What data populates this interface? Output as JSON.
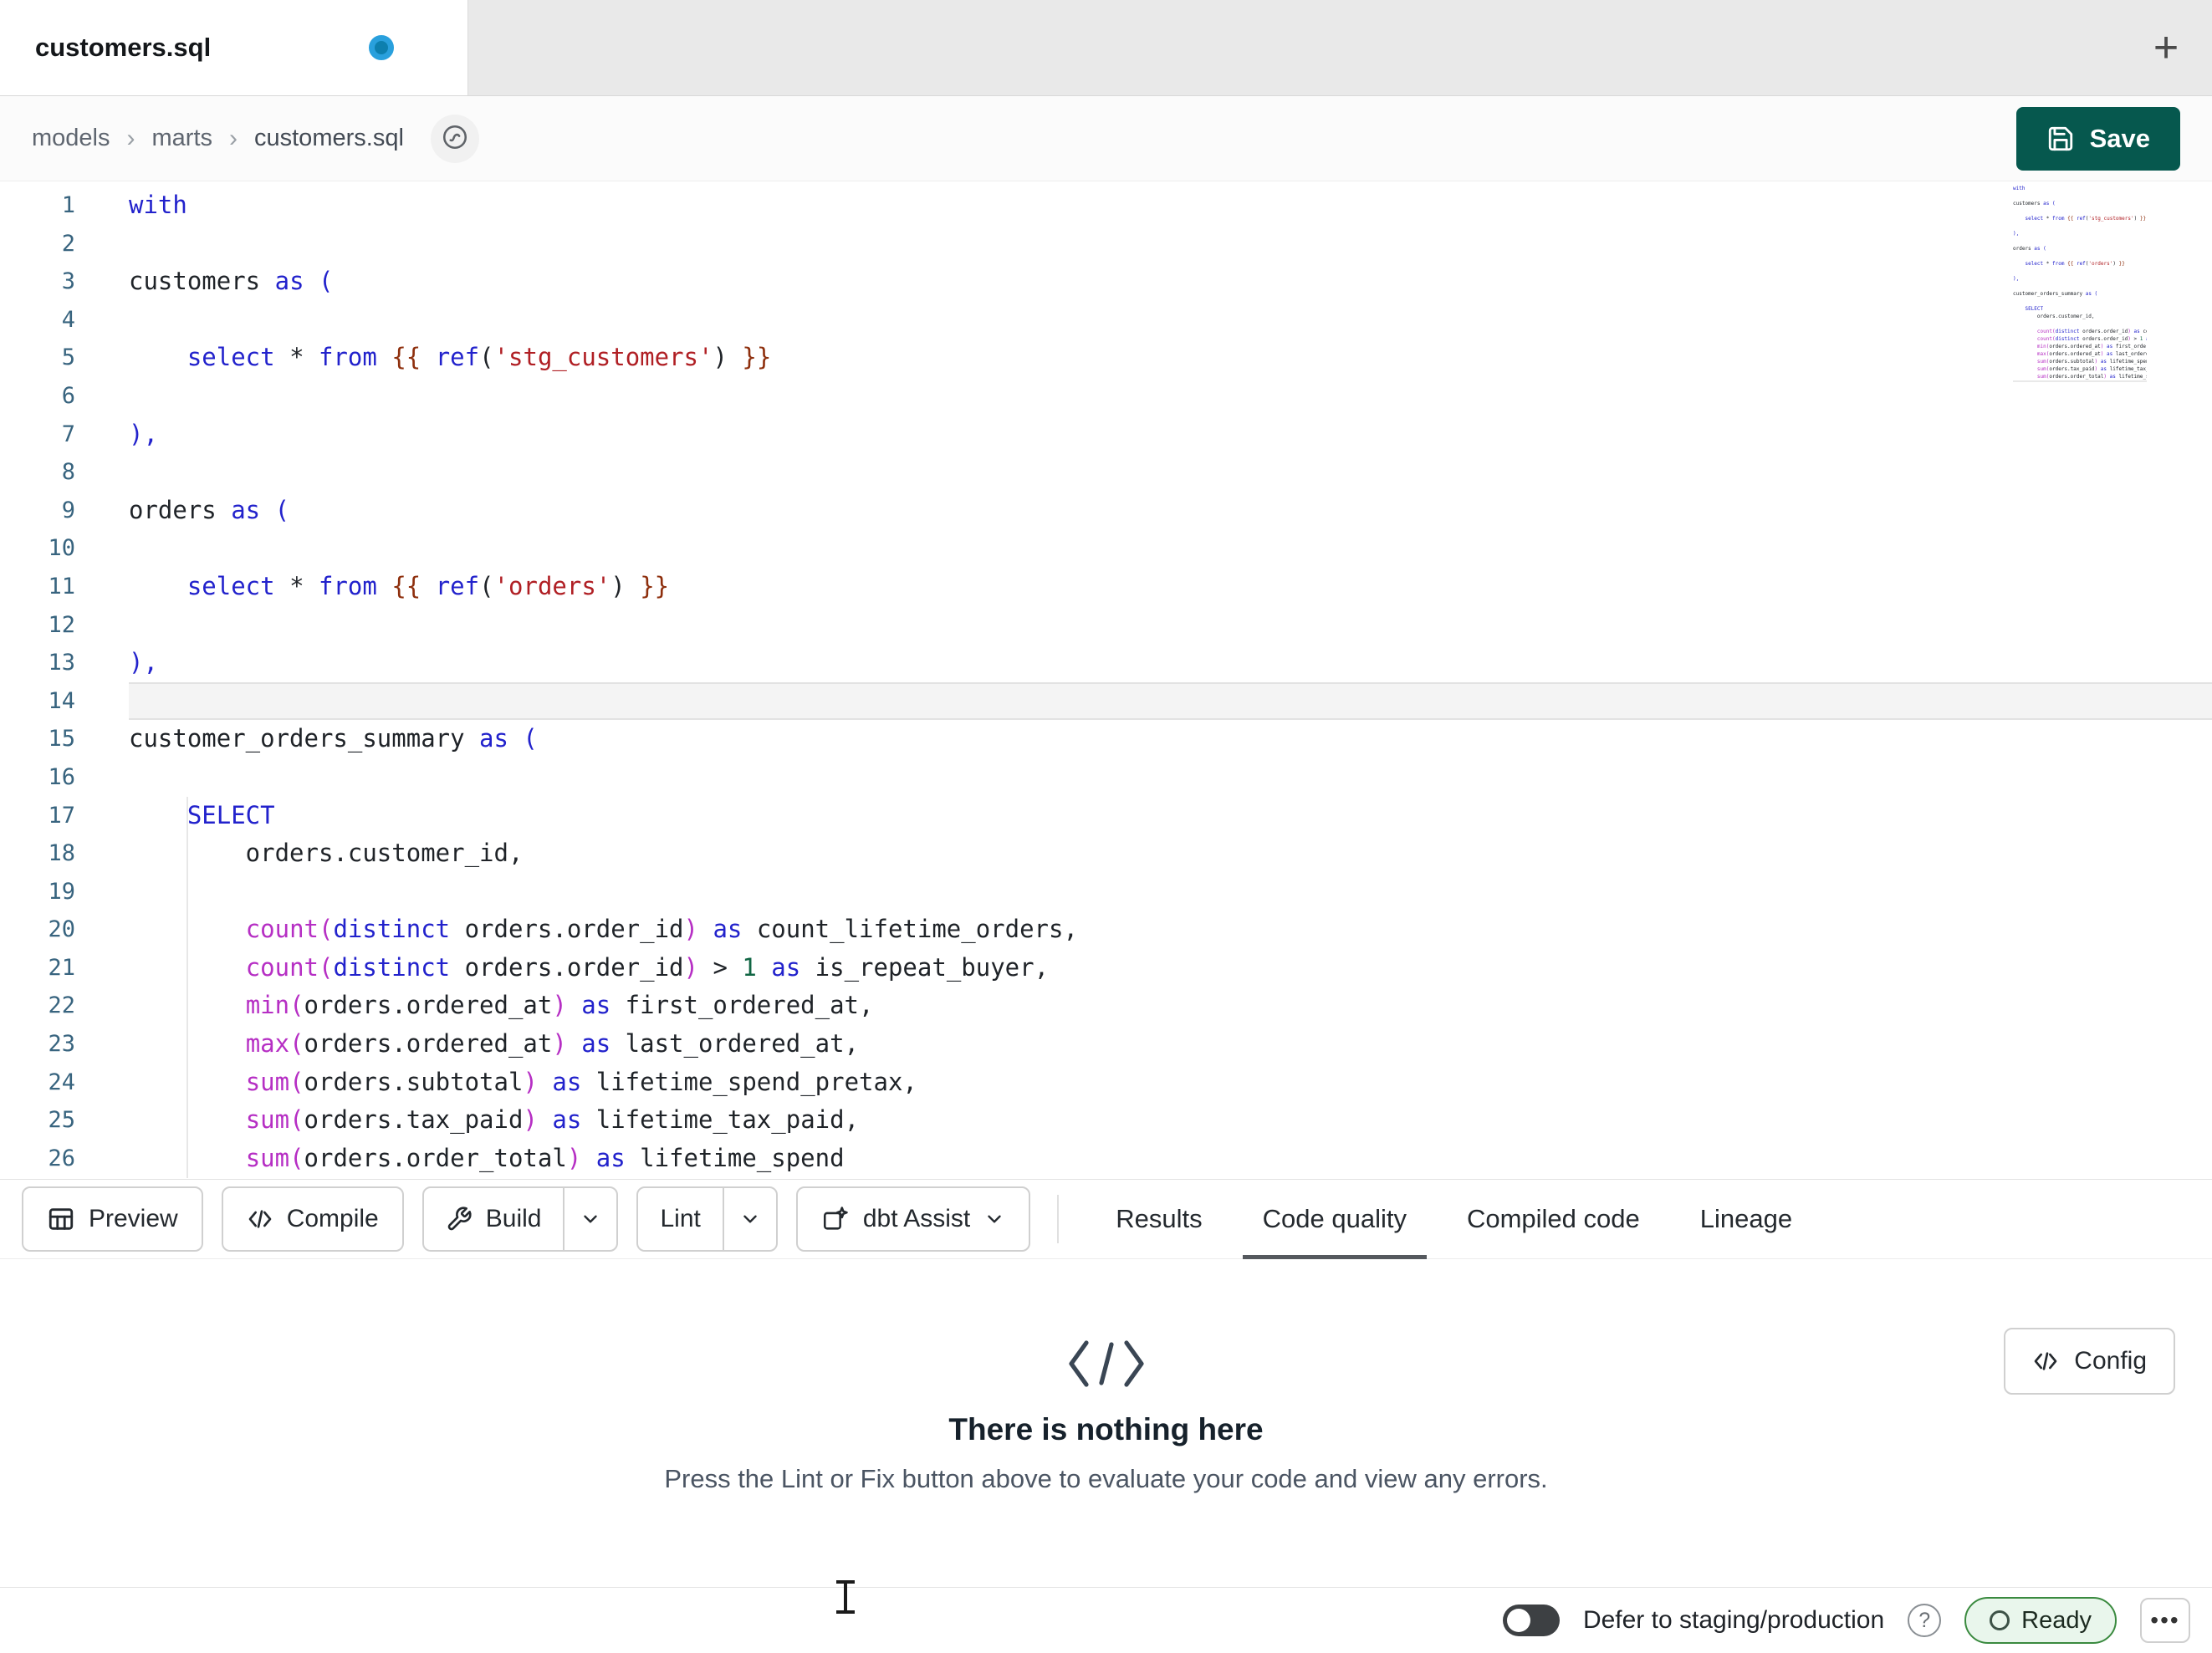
{
  "colors": {
    "save": "#06584e",
    "kw": "#2222cc",
    "fn": "#b62fc4",
    "str": "#b01f24",
    "jj": "#8e2f0d",
    "num": "#116644",
    "ln": "#38647f",
    "ready-bg": "#e9f6ec",
    "ready-border": "#3a8a3f",
    "tab-dot-outer": "#29a0dd",
    "tab-dot-inner": "#0d7fae"
  },
  "tab_bar": {
    "active_tab_title": "customers.sql",
    "new_tab_label": "+"
  },
  "breadcrumb": {
    "items": [
      "models",
      "marts",
      "customers.sql"
    ],
    "separator": "›"
  },
  "header": {
    "save_label": "Save"
  },
  "editor": {
    "current_line": 14,
    "lines": [
      {
        "n": 1,
        "s": [
          [
            "kw",
            "with"
          ]
        ]
      },
      {
        "n": 2,
        "s": []
      },
      {
        "n": 3,
        "s": [
          [
            "id",
            "customers "
          ],
          [
            "kw",
            "as"
          ],
          [
            "br",
            " ("
          ]
        ]
      },
      {
        "n": 4,
        "s": []
      },
      {
        "n": 5,
        "s": [
          [
            "id",
            "    "
          ],
          [
            "kw",
            "select"
          ],
          [
            "id",
            " "
          ],
          [
            "op",
            "*"
          ],
          [
            "id",
            " "
          ],
          [
            "kw",
            "from"
          ],
          [
            "id",
            " "
          ],
          [
            "jj",
            "{{"
          ],
          [
            "id",
            " "
          ],
          [
            "kw",
            "ref"
          ],
          [
            "pn",
            "("
          ],
          [
            "str",
            "'stg_customers'"
          ],
          [
            "pn",
            ")"
          ],
          [
            "id",
            " "
          ],
          [
            "jj",
            "}}"
          ]
        ]
      },
      {
        "n": 6,
        "s": []
      },
      {
        "n": 7,
        "s": [
          [
            "br",
            "),"
          ]
        ]
      },
      {
        "n": 8,
        "s": []
      },
      {
        "n": 9,
        "s": [
          [
            "id",
            "orders "
          ],
          [
            "kw",
            "as"
          ],
          [
            "br",
            " ("
          ]
        ]
      },
      {
        "n": 10,
        "s": []
      },
      {
        "n": 11,
        "s": [
          [
            "id",
            "    "
          ],
          [
            "kw",
            "select"
          ],
          [
            "id",
            " "
          ],
          [
            "op",
            "*"
          ],
          [
            "id",
            " "
          ],
          [
            "kw",
            "from"
          ],
          [
            "id",
            " "
          ],
          [
            "jj",
            "{{"
          ],
          [
            "id",
            " "
          ],
          [
            "kw",
            "ref"
          ],
          [
            "pn",
            "("
          ],
          [
            "str",
            "'orders'"
          ],
          [
            "pn",
            ")"
          ],
          [
            "id",
            " "
          ],
          [
            "jj",
            "}}"
          ]
        ]
      },
      {
        "n": 12,
        "s": []
      },
      {
        "n": 13,
        "s": [
          [
            "br",
            "),"
          ]
        ]
      },
      {
        "n": 14,
        "s": []
      },
      {
        "n": 15,
        "s": [
          [
            "id",
            "customer_orders_summary "
          ],
          [
            "kw",
            "as"
          ],
          [
            "br",
            " ("
          ]
        ]
      },
      {
        "n": 16,
        "s": []
      },
      {
        "n": 17,
        "s": [
          [
            "id",
            "    "
          ],
          [
            "kw",
            "SELECT"
          ]
        ]
      },
      {
        "n": 18,
        "s": [
          [
            "id",
            "        orders.customer_id,"
          ]
        ]
      },
      {
        "n": 19,
        "s": []
      },
      {
        "n": 20,
        "s": [
          [
            "id",
            "        "
          ],
          [
            "fn",
            "count("
          ],
          [
            "kw",
            "distinct"
          ],
          [
            "id",
            " orders.order_id"
          ],
          [
            "fn",
            ")"
          ],
          [
            "id",
            " "
          ],
          [
            "kw",
            "as"
          ],
          [
            "id",
            " count_lifetime_orders,"
          ]
        ]
      },
      {
        "n": 21,
        "s": [
          [
            "id",
            "        "
          ],
          [
            "fn",
            "count("
          ],
          [
            "kw",
            "distinct"
          ],
          [
            "id",
            " orders.order_id"
          ],
          [
            "fn",
            ")"
          ],
          [
            "id",
            " "
          ],
          [
            "op",
            "> "
          ],
          [
            "num",
            "1"
          ],
          [
            "id",
            " "
          ],
          [
            "kw",
            "as"
          ],
          [
            "id",
            " is_repeat_buyer,"
          ]
        ]
      },
      {
        "n": 22,
        "s": [
          [
            "id",
            "        "
          ],
          [
            "fn",
            "min("
          ],
          [
            "id",
            "orders.ordered_at"
          ],
          [
            "fn",
            ")"
          ],
          [
            "id",
            " "
          ],
          [
            "kw",
            "as"
          ],
          [
            "id",
            " first_ordered_at,"
          ]
        ]
      },
      {
        "n": 23,
        "s": [
          [
            "id",
            "        "
          ],
          [
            "fn",
            "max("
          ],
          [
            "id",
            "orders.ordered_at"
          ],
          [
            "fn",
            ")"
          ],
          [
            "id",
            " "
          ],
          [
            "kw",
            "as"
          ],
          [
            "id",
            " last_ordered_at,"
          ]
        ]
      },
      {
        "n": 24,
        "s": [
          [
            "id",
            "        "
          ],
          [
            "fn",
            "sum("
          ],
          [
            "id",
            "orders.subtotal"
          ],
          [
            "fn",
            ")"
          ],
          [
            "id",
            " "
          ],
          [
            "kw",
            "as"
          ],
          [
            "id",
            " lifetime_spend_pretax,"
          ]
        ]
      },
      {
        "n": 25,
        "s": [
          [
            "id",
            "        "
          ],
          [
            "fn",
            "sum("
          ],
          [
            "id",
            "orders.tax_paid"
          ],
          [
            "fn",
            ")"
          ],
          [
            "id",
            " "
          ],
          [
            "kw",
            "as"
          ],
          [
            "id",
            " lifetime_tax_paid,"
          ]
        ]
      },
      {
        "n": 26,
        "s": [
          [
            "id",
            "        "
          ],
          [
            "fn",
            "sum("
          ],
          [
            "id",
            "orders.order_total"
          ],
          [
            "fn",
            ")"
          ],
          [
            "id",
            " "
          ],
          [
            "kw",
            "as"
          ],
          [
            "id",
            " lifetime_spend"
          ]
        ]
      }
    ]
  },
  "toolbar": {
    "preview_label": "Preview",
    "compile_label": "Compile",
    "build_label": "Build",
    "lint_label": "Lint",
    "assist_label": "dbt Assist",
    "tabs": [
      {
        "label": "Results",
        "active": false
      },
      {
        "label": "Code quality",
        "active": true
      },
      {
        "label": "Compiled code",
        "active": false
      },
      {
        "label": "Lineage",
        "active": false
      }
    ]
  },
  "results_panel": {
    "title": "There is nothing here",
    "message": "Press the Lint or Fix button above to evaluate your code and view any errors.",
    "config_label": "Config"
  },
  "status_bar": {
    "defer_label": "Defer to staging/production",
    "help_label": "?",
    "ready_label": "Ready",
    "more_label": "•••"
  }
}
